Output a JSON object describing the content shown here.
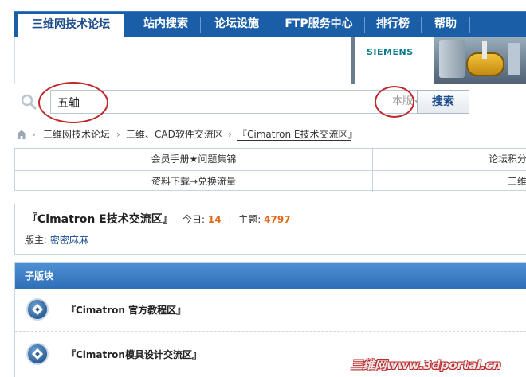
{
  "nav": {
    "items": [
      "三维网技术论坛",
      "站内搜索",
      "论坛设施",
      "FTP服务中心",
      "排行榜",
      "帮助"
    ],
    "active_index": 0
  },
  "banner": {
    "logo": "SIEMENS"
  },
  "search": {
    "query": "五轴",
    "scope": "本版",
    "button": "搜索"
  },
  "breadcrumb": {
    "items": [
      "三维网技术论坛",
      "三维、CAD软件交流区",
      "『Cimatron E技术交流区』"
    ]
  },
  "links": {
    "row1": {
      "left": "会员手册★问题集锦",
      "right": "论坛积分"
    },
    "row2": {
      "left": "资料下载→兑换流量",
      "right": "三维"
    }
  },
  "forum": {
    "title": "『Cimatron E技术交流区』",
    "today_label": "今日:",
    "today_value": "14",
    "topics_label": "主题:",
    "topics_value": "4797",
    "moderator_label": "版主:",
    "moderator_name": "密密麻麻"
  },
  "subforums": {
    "header": "子版块",
    "items": [
      "『Cimatron 官方教程区』",
      "『Cimatron模具设计交流区』"
    ]
  },
  "watermark": "三维网www.3dportal.cn",
  "colors": {
    "nav_bg": "#1a5ea8",
    "accent": "#1a4c8c",
    "stat_number": "#e06b1a",
    "annotation_circle": "#c0282a"
  }
}
